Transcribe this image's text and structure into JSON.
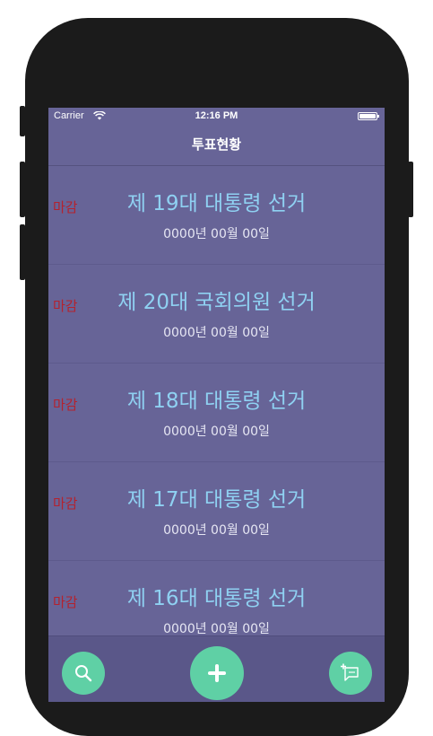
{
  "status_bar": {
    "carrier": "Carrier",
    "time": "12:16 PM"
  },
  "nav": {
    "title": "투표현황"
  },
  "elections": [
    {
      "status": "마감",
      "title": "제 19대 대통령 선거",
      "date": "0000년 00월 00일"
    },
    {
      "status": "마감",
      "title": "제 20대 국회의원 선거",
      "date": "0000년 00월 00일"
    },
    {
      "status": "마감",
      "title": "제 18대 대통령 선거",
      "date": "0000년 00월 00일"
    },
    {
      "status": "마감",
      "title": "제 17대 대통령 선거",
      "date": "0000년 00월 00일"
    },
    {
      "status": "마감",
      "title": "제 16대 대통령 선거",
      "date": "0000년 00월 00일"
    }
  ],
  "toolbar": {
    "buttons": [
      "search-icon",
      "plus-icon",
      "comment-add-icon"
    ]
  },
  "colors": {
    "background": "#676497",
    "title": "#8fd1f2",
    "status": "#b4222e",
    "accent": "#5fd0a5"
  }
}
